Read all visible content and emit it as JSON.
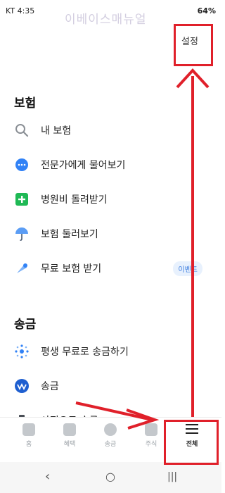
{
  "status_bar": {
    "carrier_time": "KT 4:35",
    "battery": "64%"
  },
  "watermark": "이베이스매뉴얼",
  "header": {
    "settings_label": "설정"
  },
  "sections": [
    {
      "title": "보험",
      "items": [
        {
          "label": "내 보험",
          "icon": "search-icon"
        },
        {
          "label": "전문가에게 물어보기",
          "icon": "chat-bubble-icon"
        },
        {
          "label": "병원비 돌려받기",
          "icon": "plus-box-icon"
        },
        {
          "label": "보험 둘러보기",
          "icon": "umbrella-icon"
        },
        {
          "label": "무료 보험 받기",
          "icon": "gift-icon",
          "badge": "이벤트"
        }
      ]
    },
    {
      "title": "송금",
      "items": [
        {
          "label": "평생 무료로 송금하기",
          "icon": "sparkle-icon"
        },
        {
          "label": "송금",
          "icon": "transfer-icon"
        },
        {
          "label": "사진으로 송금",
          "icon": "camera-icon"
        }
      ]
    }
  ],
  "bottom_nav": [
    {
      "label": "홈",
      "icon": "home-icon"
    },
    {
      "label": "혜택",
      "icon": "gift-icon"
    },
    {
      "label": "송금",
      "icon": "transfer-icon"
    },
    {
      "label": "주식",
      "icon": "chart-icon"
    },
    {
      "label": "전체",
      "icon": "menu-icon",
      "active": true
    }
  ],
  "colors": {
    "accent": "#3182f6",
    "annotation": "#e0202a"
  }
}
